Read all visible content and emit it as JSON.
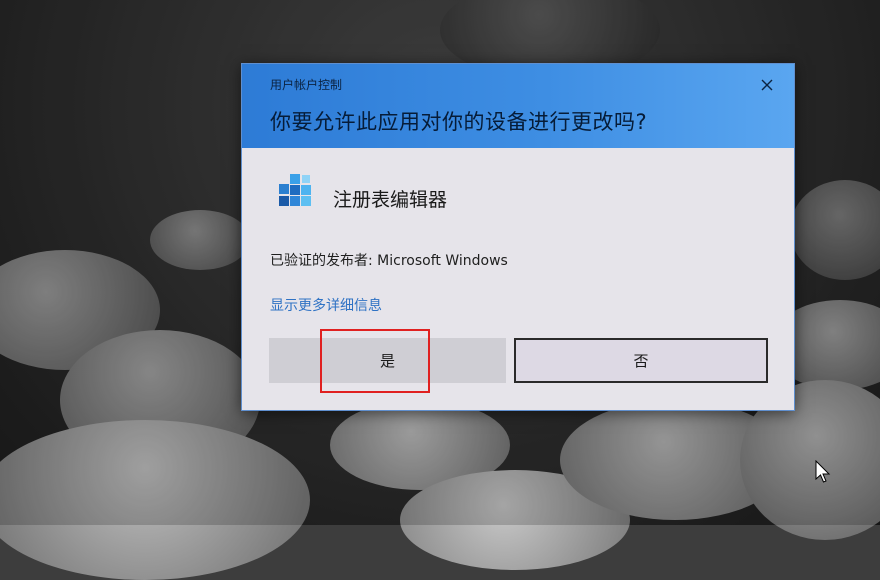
{
  "dialog": {
    "title": "用户帐户控制",
    "question": "你要允许此应用对你的设备进行更改吗?",
    "app_name": "注册表编辑器",
    "publisher": "已验证的发布者: Microsoft Windows",
    "details_link": "显示更多详细信息",
    "yes_label": "是",
    "no_label": "否"
  },
  "icons": {
    "close": "close-icon",
    "app": "registry-editor-icon",
    "cursor": "mouse-cursor-icon"
  },
  "colors": {
    "header": "#3e8ee3",
    "body": "#e6e4ea",
    "link": "#2f72c4",
    "highlight": "#e02020"
  }
}
